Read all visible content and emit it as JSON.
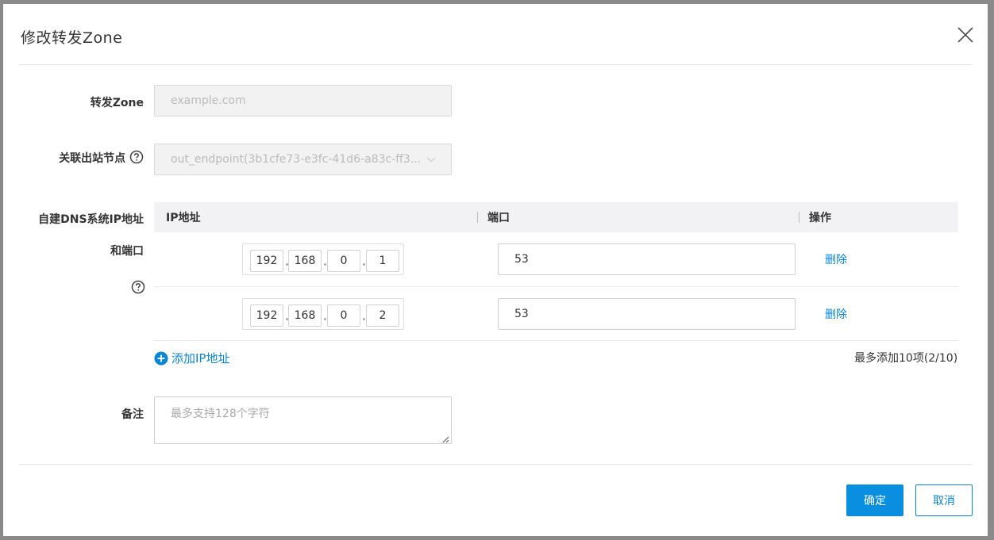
{
  "dialog": {
    "title": "修改转发Zone",
    "close_icon": "close-icon"
  },
  "zone": {
    "label": "转发Zone",
    "placeholder": "example.com"
  },
  "endpoint": {
    "label": "关联出站节点",
    "value": "out_endpoint(3b1cfe73-e3fc-41d6-a83c-ff3...",
    "help_icon": "question-circle-icon",
    "arrow_icon": "chevron-down-icon"
  },
  "dns": {
    "label_line1": "自建DNS系统IP地址",
    "label_line2": "和端口",
    "columns": [
      "IP地址",
      "端口",
      "操作"
    ],
    "rows": [
      {
        "ip": [
          "192",
          "168",
          "0",
          "1"
        ],
        "port": "53",
        "action": "删除"
      },
      {
        "ip": [
          "192",
          "168",
          "0",
          "2"
        ],
        "port": "53",
        "action": "删除"
      }
    ],
    "add_label": "添加IP地址",
    "limit_text": "最多添加10项(2/10)"
  },
  "remark": {
    "label": "备注",
    "placeholder": "最多支持128个字符"
  },
  "footer": {
    "ok": "确定",
    "cancel": "取消"
  },
  "colors": {
    "primary": "#0a8ee0",
    "link": "#0a86d8",
    "overlay": "#8a8a8a"
  }
}
